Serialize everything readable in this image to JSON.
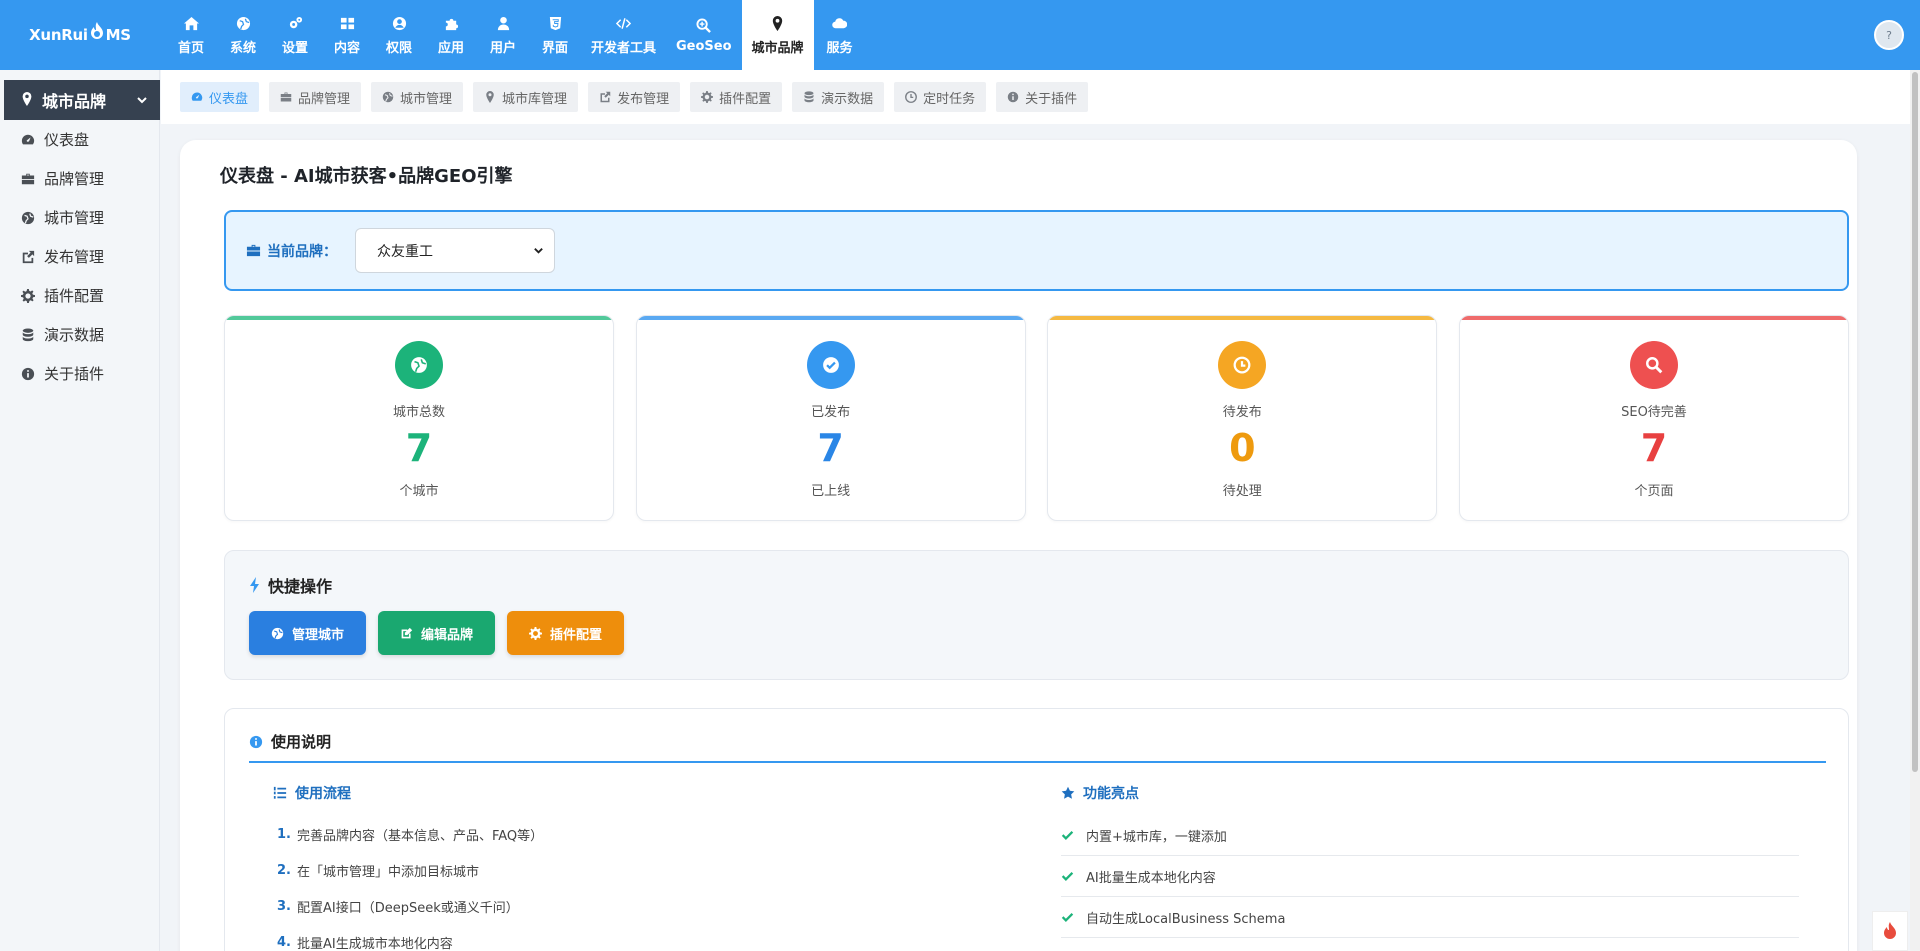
{
  "topnav": {
    "logo": {
      "part1": "XunRui",
      "part2": "MS"
    },
    "items": [
      {
        "label": "首页",
        "icon": "home-icon"
      },
      {
        "label": "系统",
        "icon": "globe-icon"
      },
      {
        "label": "设置",
        "icon": "gears-icon"
      },
      {
        "label": "内容",
        "icon": "grid-icon"
      },
      {
        "label": "权限",
        "icon": "user-circle-icon"
      },
      {
        "label": "应用",
        "icon": "puzzle-icon"
      },
      {
        "label": "用户",
        "icon": "user-icon"
      },
      {
        "label": "界面",
        "icon": "html5-icon"
      },
      {
        "label": "开发者工具",
        "icon": "code-icon"
      },
      {
        "label": "GeoSeo",
        "icon": "search-plus-icon"
      },
      {
        "label": "城市品牌",
        "icon": "map-marker-icon",
        "active": true
      },
      {
        "label": "服务",
        "icon": "cloud-icon"
      }
    ],
    "avatar_text": "?"
  },
  "sidebar": {
    "header": "城市品牌",
    "items": [
      {
        "label": "仪表盘",
        "icon": "dashboard-icon"
      },
      {
        "label": "品牌管理",
        "icon": "briefcase-icon"
      },
      {
        "label": "城市管理",
        "icon": "globe-icon"
      },
      {
        "label": "发布管理",
        "icon": "share-icon"
      },
      {
        "label": "插件配置",
        "icon": "gear-icon"
      },
      {
        "label": "演示数据",
        "icon": "database-icon"
      },
      {
        "label": "关于插件",
        "icon": "info-icon"
      }
    ]
  },
  "subtabs": [
    {
      "label": "仪表盘",
      "icon": "dashboard-icon",
      "active": true
    },
    {
      "label": "品牌管理",
      "icon": "briefcase-icon"
    },
    {
      "label": "城市管理",
      "icon": "globe-icon"
    },
    {
      "label": "城市库管理",
      "icon": "map-marker-icon"
    },
    {
      "label": "发布管理",
      "icon": "share-icon"
    },
    {
      "label": "插件配置",
      "icon": "gear-icon"
    },
    {
      "label": "演示数据",
      "icon": "database-icon"
    },
    {
      "label": "定时任务",
      "icon": "clock-icon"
    },
    {
      "label": "关于插件",
      "icon": "info-icon"
    }
  ],
  "page": {
    "title": "仪表盘 - AI城市获客•品牌GEO引擎",
    "brand": {
      "label": "当前品牌：",
      "selected": "众友重工"
    },
    "stats": [
      {
        "label": "城市总数",
        "value": "7",
        "unit": "个城市",
        "color": "#1cb37a",
        "icon": "globe-icon"
      },
      {
        "label": "已发布",
        "value": "7",
        "unit": "已上线",
        "color": "#3598f0",
        "icon": "check-circle-icon"
      },
      {
        "label": "待发布",
        "value": "0",
        "unit": "待处理",
        "color": "#f39c12",
        "icon": "clock-icon"
      },
      {
        "label": "SEO待完善",
        "value": "7",
        "unit": "个页面",
        "color": "#e84c4c",
        "icon": "search-icon"
      }
    ],
    "quick": {
      "title": "快捷操作",
      "buttons": [
        {
          "label": "管理城市",
          "color": "#2a7fe0",
          "icon": "globe-icon"
        },
        {
          "label": "编辑品牌",
          "color": "#1aa870",
          "icon": "edit-icon"
        },
        {
          "label": "插件配置",
          "color": "#ee8e0c",
          "icon": "gear-icon"
        }
      ]
    },
    "guide": {
      "title": "使用说明",
      "flow_title": "使用流程",
      "steps": [
        {
          "n": "1.",
          "text": "完善品牌内容（基本信息、产品、FAQ等）"
        },
        {
          "n": "2.",
          "text": "在「城市管理」中添加目标城市"
        },
        {
          "n": "3.",
          "text": "配置AI接口（DeepSeek或通义千问）"
        },
        {
          "n": "4.",
          "text": "批量AI生成城市本地化内容"
        }
      ],
      "features_title": "功能亮点",
      "features": [
        "内置+城市库，一键添加",
        "AI批量生成本地化内容",
        "自动生成LocalBusiness Schema"
      ]
    }
  }
}
